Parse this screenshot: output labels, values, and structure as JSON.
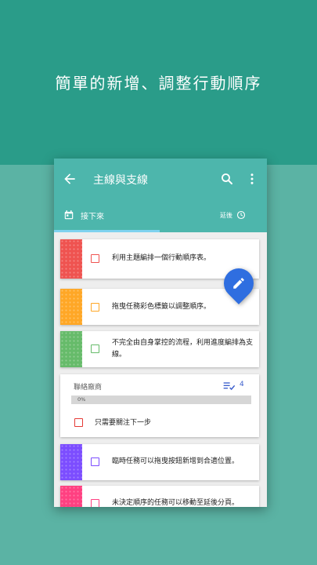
{
  "hero": {
    "title": "簡單的新增、調整行動順序"
  },
  "appbar": {
    "title": "主線與支線"
  },
  "tabs": {
    "next_label": "接下來",
    "later_label": "延後"
  },
  "tasks": [
    {
      "text": "利用主題編排一個行動順序表。",
      "color": "#ef5350"
    },
    {
      "text": "拖曳任務彩色標籤以調整順序。",
      "color": "#ffa726"
    },
    {
      "text": "不完全由自身掌控的流程，利用進度編排為支線。",
      "color": "#66bb6a"
    }
  ],
  "group": {
    "name": "聯絡廠商",
    "count": "4",
    "progress_label": "0%",
    "progress": 0,
    "task_text": "只需要關注下一步",
    "task_color": "#e53935"
  },
  "bottom_tasks": [
    {
      "text": "臨時任務可以拖曳按鈕新增到合適位置。",
      "color": "#7c4dff"
    },
    {
      "text": "未決定順序的任務可以移動至延後分頁。",
      "color": "#ff4081"
    }
  ],
  "colors": {
    "hero_bg": "#2a9c89",
    "body_bg": "#5bb3a4",
    "appbar": "#4db6ac",
    "fab": "#2f6ee0",
    "indicator": "#7fd2ef"
  }
}
